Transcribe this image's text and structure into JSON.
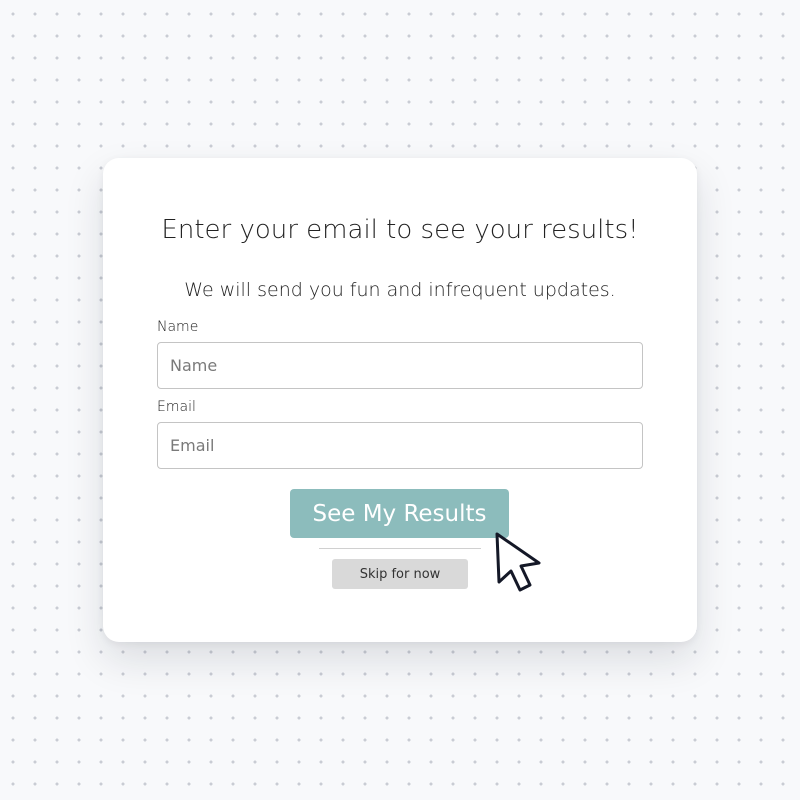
{
  "signup_card": {
    "heading": "Enter your email to see your results!",
    "subheading": "We will send you fun and infrequent updates.",
    "name_field": {
      "label": "Name",
      "placeholder": "Name",
      "value": ""
    },
    "email_field": {
      "label": "Email",
      "placeholder": "Email",
      "value": ""
    },
    "submit_label": "See My Results",
    "skip_label": "Skip for now"
  },
  "cursor_icon": "mouse-pointer-icon",
  "colors": {
    "background": "#f8f9fb",
    "card": "#ffffff",
    "primary_button": "#8cbcbc",
    "secondary_button": "#d9d9d9",
    "text": "#222222"
  }
}
